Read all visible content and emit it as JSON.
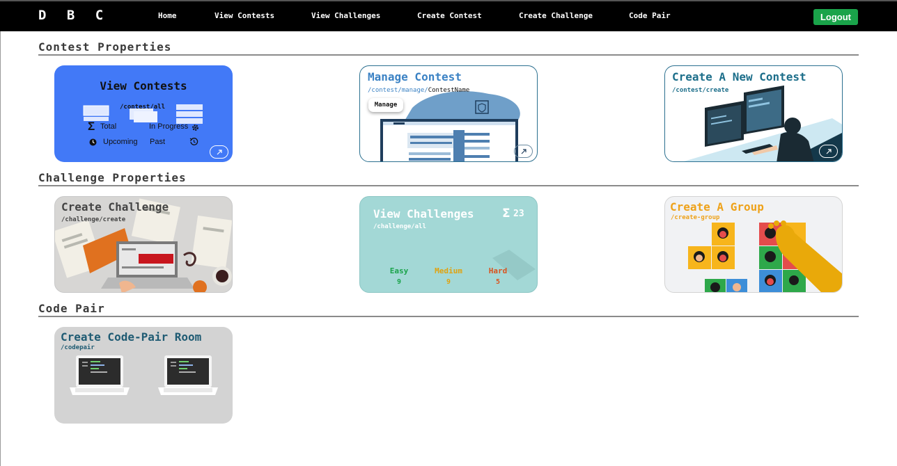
{
  "navbar": {
    "brand": "D B C",
    "links": [
      "Home",
      "View Contests",
      "View Challenges",
      "Create Contest",
      "Create Challenge",
      "Code Pair"
    ],
    "logout_label": "Logout",
    "logout_color": "#1aa34a"
  },
  "sections": {
    "contest": "Contest Properties",
    "challenge": "Challenge Properties",
    "codepair": "Code Pair"
  },
  "contest_cards": {
    "view": {
      "title": "View Contests",
      "path": "/contest/all",
      "stats": [
        "Total",
        "In Progress",
        "Upcoming",
        "Past"
      ],
      "bg": "#4279f7"
    },
    "manage": {
      "title": "Manage Contest",
      "path_prefix": "/contest/manage/",
      "path_param": "ContestName",
      "manage_label": "Manage"
    },
    "create": {
      "title": "Create A New Contest",
      "path": "/contest/create"
    }
  },
  "challenge_cards": {
    "create": {
      "title": "Create Challenge",
      "path": "/challenge/create"
    },
    "view": {
      "title": "View Challenges",
      "path": "/challenge/all",
      "total_symbol": "Σ",
      "total": "23",
      "difficulties": [
        {
          "label": "Easy",
          "count": "9",
          "color": "#1aa34a"
        },
        {
          "label": "Medium",
          "count": "9",
          "color": "#e0a20f"
        },
        {
          "label": "Hard",
          "count": "5",
          "color": "#d9531e"
        }
      ]
    },
    "group": {
      "title": "Create A Group",
      "path": "/create-group"
    }
  },
  "codepair_card": {
    "title": "Create Code-Pair Room",
    "path": "/codepair"
  },
  "icons": {
    "sum": "Σ",
    "arrow": "↗"
  }
}
